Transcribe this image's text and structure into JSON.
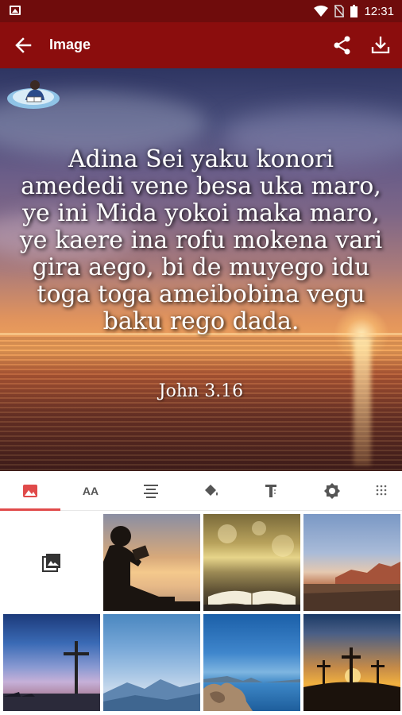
{
  "status_bar": {
    "time": "12:31",
    "icons": [
      "image-icon",
      "wifi-icon",
      "no-sim-icon",
      "battery-icon"
    ]
  },
  "app_bar": {
    "title": "Image",
    "back_icon": "arrow-left-icon",
    "share_icon": "share-icon",
    "download_icon": "download-icon",
    "color": "#8b0d0d"
  },
  "hero": {
    "verse": "Adina Sei yaku konori amededi vene besa uka maro, ye ini Mida yokoi maka maro, ye kaere ina rofu mokena vari gira aego, bi de muyego idu toga toga ameibobina vegu baku rego dada.",
    "reference": "John 3.16"
  },
  "tabs": [
    {
      "name": "tab-background",
      "icon": "image-icon",
      "active": true
    },
    {
      "name": "tab-font",
      "icon": "font-size-icon",
      "label": "AA",
      "active": false
    },
    {
      "name": "tab-align",
      "icon": "align-center-icon",
      "active": false
    },
    {
      "name": "tab-color",
      "icon": "paint-bucket-icon",
      "active": false
    },
    {
      "name": "tab-text-style",
      "icon": "text-format-icon",
      "active": false
    },
    {
      "name": "tab-brightness",
      "icon": "brightness-icon",
      "active": false
    },
    {
      "name": "tab-more",
      "icon": "grid-dots-icon",
      "active": false
    }
  ],
  "gallery": {
    "pick_icon": "photo-library-icon",
    "thumbnails": [
      "boy-reading-silhouette",
      "open-bible-bokeh",
      "desert-mountains",
      "cross-at-dusk",
      "misty-mountains",
      "rocky-seashore",
      "three-crosses-sunset"
    ]
  },
  "accent_color": "#e04a4a"
}
